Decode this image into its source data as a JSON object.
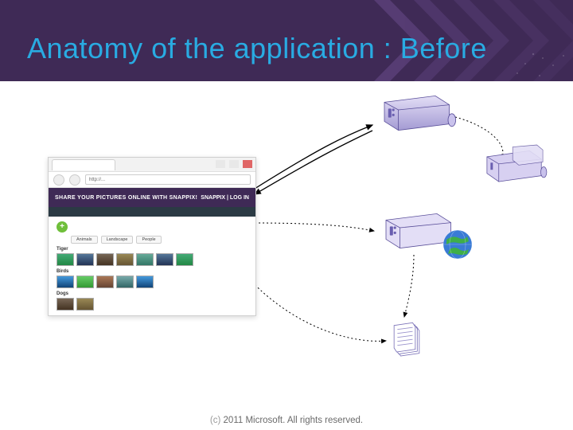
{
  "title": "Anatomy of the application : Before",
  "footer": {
    "prefix": "(c)",
    "rest": " 2011 Microsoft. All rights reserved."
  },
  "colors": {
    "header_bg": "#3f2a56",
    "title": "#29abe2"
  },
  "browser": {
    "url": "http://...",
    "banner": "SHARE YOUR PICTURES ONLINE WITH SNAPPIX!",
    "logo": "SNAPPIX | LOG IN",
    "tabs": [
      "Animals",
      "Landscape",
      "People"
    ],
    "categories": [
      {
        "label": "Tiger"
      },
      {
        "label": "Birds"
      },
      {
        "label": "Dogs"
      }
    ]
  },
  "diagram": {
    "nodes": {
      "client": "web-browser-client",
      "server_top": "server-1",
      "server_right": "server-2-pair",
      "server_middle": "server-web",
      "globe": "internet-globe",
      "pages": "document-stack"
    }
  }
}
